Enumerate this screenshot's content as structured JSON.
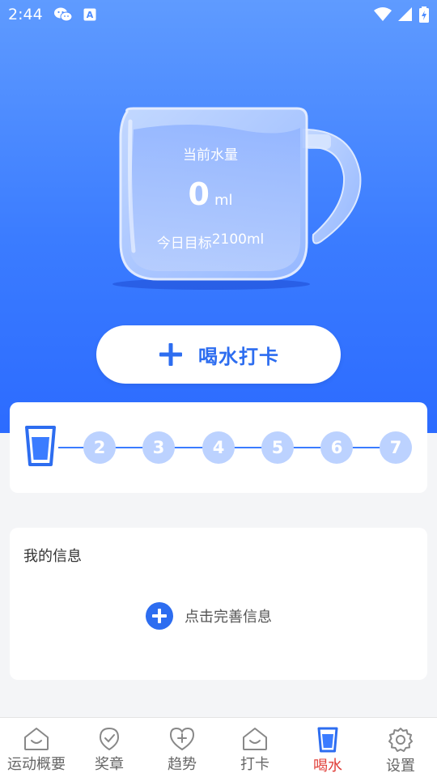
{
  "status_bar": {
    "time": "2:44",
    "icons": [
      "wechat-icon",
      "accessibility-a-icon",
      "wifi-icon",
      "signal-icon",
      "battery-icon"
    ]
  },
  "water": {
    "current_label": "当前水量",
    "current_value": "0",
    "unit": "ml",
    "goal_label": "今日目标",
    "goal_value": "2100",
    "goal_unit": "ml"
  },
  "checkin_button": {
    "label": "喝水打卡",
    "icon": "plus-icon"
  },
  "progress": {
    "day1_icon": "cup-icon",
    "days": [
      "2",
      "3",
      "4",
      "5",
      "6",
      "7"
    ],
    "colors": {
      "line": "#3b7cff",
      "dot": "#bcd2ff"
    }
  },
  "info": {
    "title": "我的信息",
    "action_label": "点击完善信息",
    "action_icon": "plus-circle-icon"
  },
  "bottom_nav": {
    "items": [
      {
        "label": "运动概要",
        "icon": "house-smile-icon"
      },
      {
        "label": "奖章",
        "icon": "check-badge-icon"
      },
      {
        "label": "趋势",
        "icon": "heart-plus-icon"
      },
      {
        "label": "打卡",
        "icon": "house-smile-icon"
      },
      {
        "label": "喝水",
        "icon": "water-cup-icon",
        "active": true
      },
      {
        "label": "设置",
        "icon": "gear-icon"
      }
    ],
    "active_color": "#e0403a"
  },
  "theme": {
    "primary": "#3b7cff",
    "hero_top": "#5f9bff"
  }
}
